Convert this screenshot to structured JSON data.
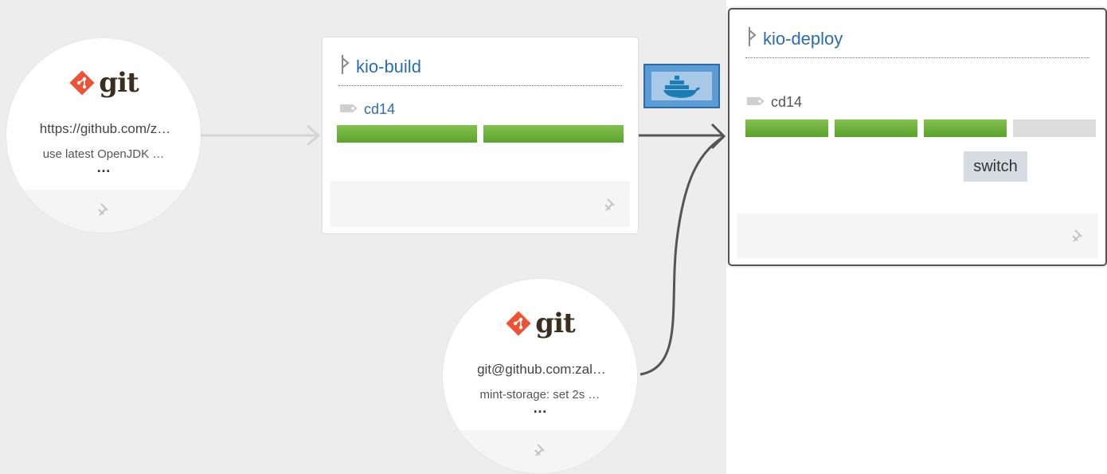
{
  "resources": [
    {
      "id": "git-1",
      "logo": "git",
      "url": "https://github.com/z…",
      "message": "use latest OpenJDK …",
      "more": "…",
      "pin_icon": "pin-icon"
    },
    {
      "id": "git-2",
      "logo": "git",
      "url": "git@github.com:zal…",
      "message": "mint-storage: set 2s …",
      "more": "…",
      "pin_icon": "pin-icon"
    }
  ],
  "jobs": [
    {
      "id": "kio-build",
      "title": "kio-build",
      "tag": "cd14",
      "builds": [
        "succeeded",
        "succeeded"
      ]
    },
    {
      "id": "kio-deploy",
      "title": "kio-deploy",
      "tag": "cd14",
      "builds": [
        "succeeded",
        "succeeded",
        "succeeded",
        "pending"
      ],
      "action_label": "switch"
    }
  ],
  "docker_badge": {
    "icon": "docker-whale-icon"
  },
  "colors": {
    "job_title": "#2a6db5",
    "build_success": "#6cb33e",
    "build_pending": "#dcdcdc",
    "git_logo": "#f05133",
    "background": "#ededed"
  }
}
